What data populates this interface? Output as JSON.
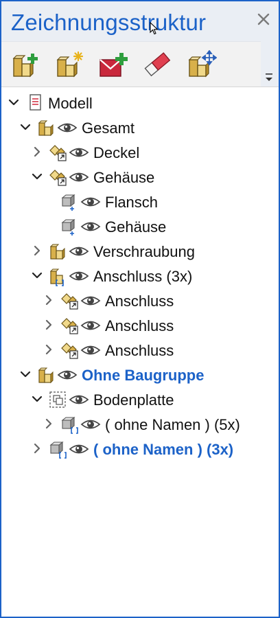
{
  "panel": {
    "title": "Zeichnungsstruktur",
    "close_icon": "close-icon"
  },
  "toolbar": {
    "tools": [
      {
        "name": "new-group-button",
        "icon": "group-add-icon"
      },
      {
        "name": "new-group-star-button",
        "icon": "group-new-icon"
      },
      {
        "name": "add-to-group-button",
        "icon": "mail-add-icon"
      },
      {
        "name": "erase-button",
        "icon": "eraser-icon"
      },
      {
        "name": "move-group-button",
        "icon": "group-move-icon"
      }
    ],
    "overflow_icon": "chevron-down-icon"
  },
  "tree": {
    "items": [
      {
        "label": "Modell",
        "level": 0,
        "expanded": true,
        "icon": "document-icon",
        "eye": false,
        "style": "normal"
      },
      {
        "label": "Gesamt",
        "level": 1,
        "expanded": true,
        "icon": "assembly-icon",
        "eye": true,
        "style": "normal"
      },
      {
        "label": "Deckel",
        "level": 2,
        "expanded": false,
        "icon": "assembly-link-icon",
        "eye": true,
        "style": "normal"
      },
      {
        "label": "Gehäuse",
        "level": 2,
        "expanded": true,
        "icon": "assembly-link-icon",
        "eye": true,
        "style": "normal"
      },
      {
        "label": "Flansch",
        "level": 3,
        "expanded": null,
        "icon": "part-icon",
        "eye": true,
        "style": "normal"
      },
      {
        "label": "Gehäuse",
        "level": 3,
        "expanded": null,
        "icon": "part-icon",
        "eye": true,
        "style": "normal"
      },
      {
        "label": "Verschraubung",
        "level": 2,
        "expanded": false,
        "icon": "assembly-icon",
        "eye": true,
        "style": "normal"
      },
      {
        "label": "Anschluss (3x)",
        "level": 2,
        "expanded": true,
        "icon": "assembly-instance-icon",
        "eye": true,
        "style": "normal"
      },
      {
        "label": "Anschluss",
        "level": 3,
        "expanded": false,
        "icon": "assembly-link-icon",
        "eye": true,
        "style": "normal"
      },
      {
        "label": "Anschluss",
        "level": 3,
        "expanded": false,
        "icon": "assembly-link-icon",
        "eye": true,
        "style": "normal"
      },
      {
        "label": "Anschluss",
        "level": 3,
        "expanded": false,
        "icon": "assembly-link-icon",
        "eye": true,
        "style": "normal"
      },
      {
        "label": "Ohne Baugruppe",
        "level": 1,
        "expanded": true,
        "icon": "assembly-icon",
        "eye": true,
        "style": "bold-blue"
      },
      {
        "label": "Bodenplatte",
        "level": 2,
        "expanded": true,
        "icon": "group-dashed-icon",
        "eye": true,
        "style": "normal"
      },
      {
        "label": "( ohne Namen ) (5x)",
        "level": 3,
        "expanded": false,
        "icon": "part-instance-icon",
        "eye": true,
        "style": "normal"
      },
      {
        "label": "( ohne Namen ) (3x)",
        "level": 2,
        "expanded": false,
        "icon": "part-instance-icon",
        "eye": true,
        "style": "bold-blue"
      }
    ]
  },
  "colors": {
    "accent": "#1c62c8",
    "titlebar_bg": "#eaeef4",
    "toolbar_bg": "#f2f2f2"
  }
}
